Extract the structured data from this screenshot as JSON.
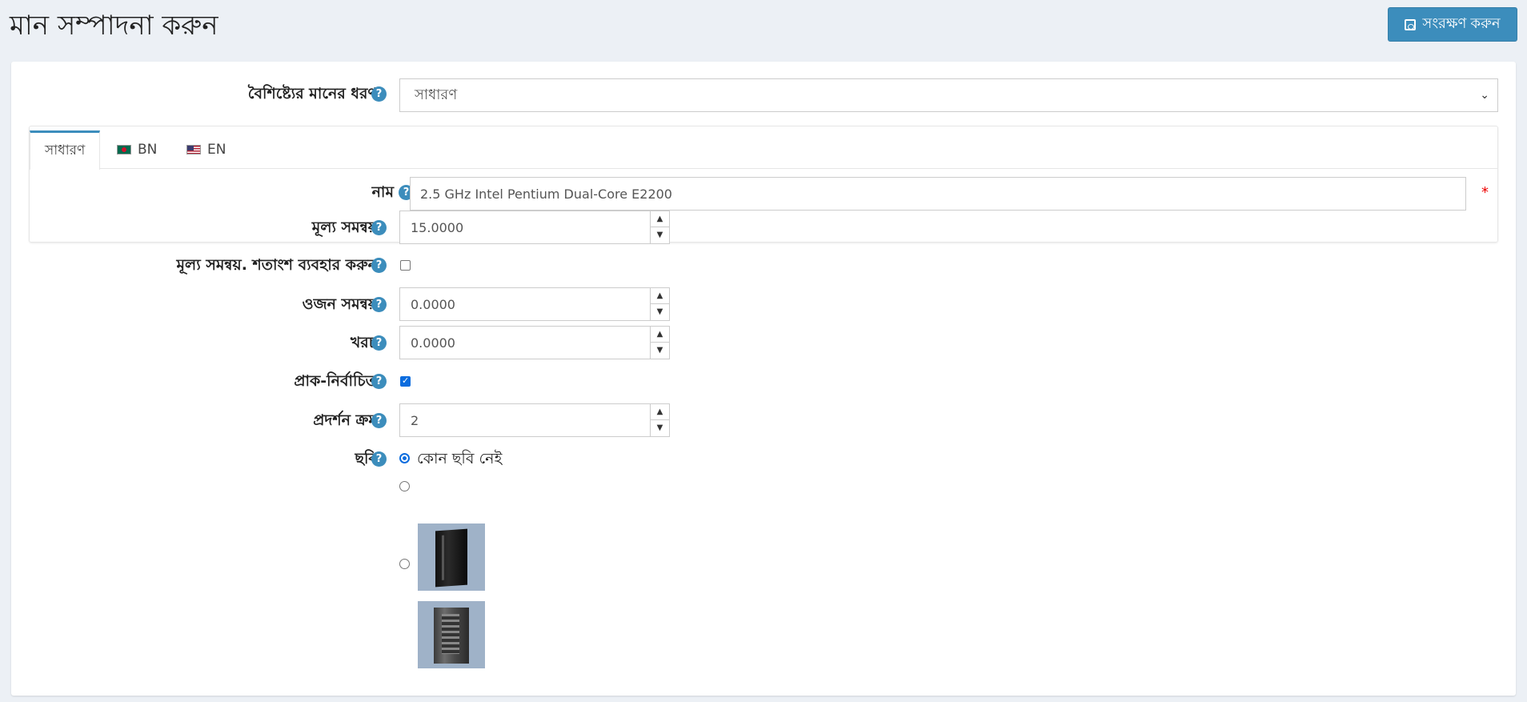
{
  "page": {
    "title": "মান সম্পাদনা করুন"
  },
  "toolbar": {
    "save_label": "সংরক্ষণ করুন"
  },
  "form": {
    "attribute_value_type": {
      "label": "বৈশিষ্ট্যের মানের ধরণ",
      "value": "সাধারণ"
    },
    "tabs": [
      {
        "label": "সাধারণ",
        "active": true
      },
      {
        "label": "BN",
        "flag": "bangladesh-flag"
      },
      {
        "label": "EN",
        "flag": "us-flag"
      }
    ],
    "name": {
      "label": "নাম",
      "value": "2.5 GHz Intel Pentium Dual-Core E2200",
      "required_mark": "*"
    },
    "price_adjustment": {
      "label": "মূল্য সমন্বয়",
      "value": "15.0000"
    },
    "price_adjustment_use_percentage": {
      "label": "মূল্য সমন্বয়. শতাংশ ব্যবহার করুন",
      "checked": false
    },
    "weight_adjustment": {
      "label": "ওজন সমন্বয়",
      "value": "0.0000"
    },
    "cost": {
      "label": "খরচ",
      "value": "0.0000"
    },
    "is_pre_selected": {
      "label": "প্রাক-নির্বাচিত",
      "checked": true
    },
    "display_order": {
      "label": "প্রদর্শন ক্রম",
      "value": "2"
    },
    "picture": {
      "label": "ছবি",
      "options": [
        {
          "label": "কোন ছবি নেই",
          "selected": true
        },
        {
          "image": "black-server-cabinet",
          "selected": false
        },
        {
          "image": "open-server-cabinet",
          "selected": false
        }
      ]
    }
  },
  "help_glyph": "?",
  "spin_up": "▲",
  "spin_down": "▼"
}
